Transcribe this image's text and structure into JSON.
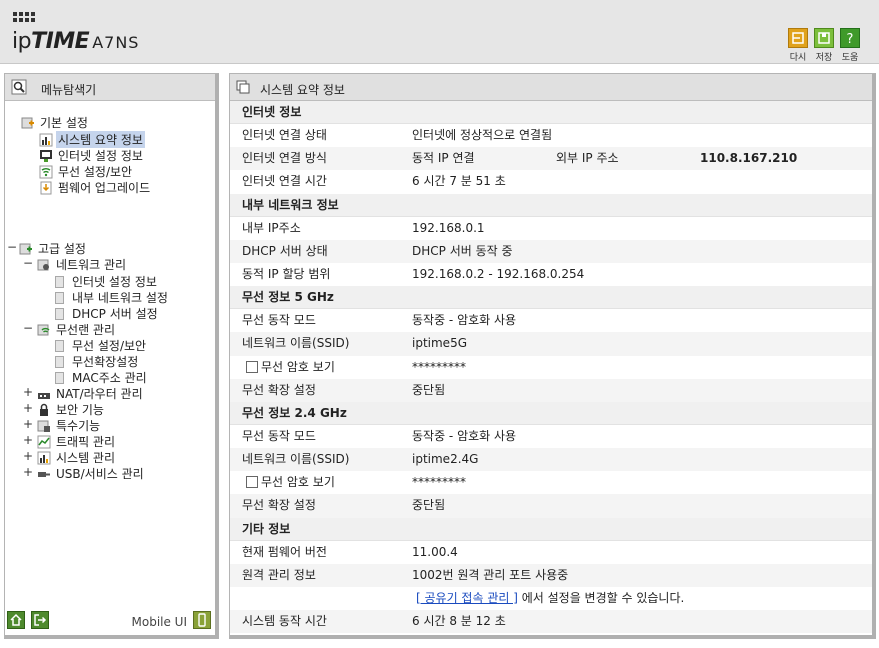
{
  "header": {
    "brand_ip": "ip",
    "brand_time": "TIME",
    "brand_model": "A7NS",
    "buttons": [
      {
        "label": "다시",
        "icon": "reload-icon",
        "color": "#e0a21c"
      },
      {
        "label": "저장",
        "icon": "save-icon",
        "color": "#7cbf3c"
      },
      {
        "label": "도움",
        "icon": "help-icon",
        "color": "#3f9a2a"
      }
    ]
  },
  "menu": {
    "title": "메뉴탐색기",
    "basic": {
      "label": "기본 설정",
      "items": [
        "시스템 요약 정보",
        "인터넷 설정 정보",
        "무선 설정/보안",
        "펌웨어 업그레이드"
      ]
    },
    "advanced": {
      "label": "고급 설정",
      "network": {
        "label": "네트워크 관리",
        "items": [
          "인터넷 설정 정보",
          "내부 네트워크 설정",
          "DHCP 서버 설정"
        ]
      },
      "wireless": {
        "label": "무선랜 관리",
        "items": [
          "무선 설정/보안",
          "무선확장설정",
          "MAC주소 관리"
        ]
      },
      "others": [
        "NAT/라우터 관리",
        "보안 기능",
        "특수기능",
        "트래픽 관리",
        "시스템 관리",
        "USB/서비스 관리"
      ]
    },
    "mobile_label": "Mobile UI"
  },
  "panel": {
    "title": "시스템 요약 정보",
    "internet": {
      "section": "인터넷 정보",
      "status_label": "인터넷 연결 상태",
      "status_value": "인터넷에 정상적으로 연결됨",
      "method_label": "인터넷 연결 방식",
      "method_value": "동적 IP 연결",
      "external_ip_label": "외부 IP 주소",
      "external_ip_value": "110.8.167.210",
      "time_label": "인터넷 연결 시간",
      "time_value": "6 시간 7 분 51 초"
    },
    "lan": {
      "section": "내부 네트워크 정보",
      "ip_label": "내부 IP주소",
      "ip_value": "192.168.0.1",
      "dhcp_label": "DHCP 서버 상태",
      "dhcp_value": "DHCP 서버 동작 중",
      "range_label": "동적 IP 할당 범위",
      "range_value": "192.168.0.2 -  192.168.0.254"
    },
    "wifi5": {
      "section": "무선 정보 5 GHz",
      "mode_label": "무선 동작 모드",
      "mode_value": "동작중 - 암호화 사용",
      "ssid_label": "네트워크 이름(SSID)",
      "ssid_value": "iptime5G",
      "pw_label": "무선 암호 보기",
      "pw_value": "*********",
      "ext_label": "무선 확장 설정",
      "ext_value": "중단됨"
    },
    "wifi24": {
      "section": "무선 정보 2.4 GHz",
      "mode_label": "무선 동작 모드",
      "mode_value": "동작중 - 암호화 사용",
      "ssid_label": "네트워크 이름(SSID)",
      "ssid_value": "iptime2.4G",
      "pw_label": "무선 암호 보기",
      "pw_value": "*********",
      "ext_label": "무선 확장 설정",
      "ext_value": "중단됨"
    },
    "etc": {
      "section": "기타 정보",
      "fw_label": "현재 펌웨어 버전",
      "fw_value": "11.00.4",
      "remote_label": "원격 관리 정보",
      "remote_value": "1002번 원격 관리 포트 사용중",
      "remote_link": "[ 공유기 접속 관리 ]",
      "remote_note": " 에서 설정을 변경할 수 있습니다.",
      "uptime_label": "시스템 동작 시간",
      "uptime_value": "6 시간 8 분 12 초"
    }
  }
}
